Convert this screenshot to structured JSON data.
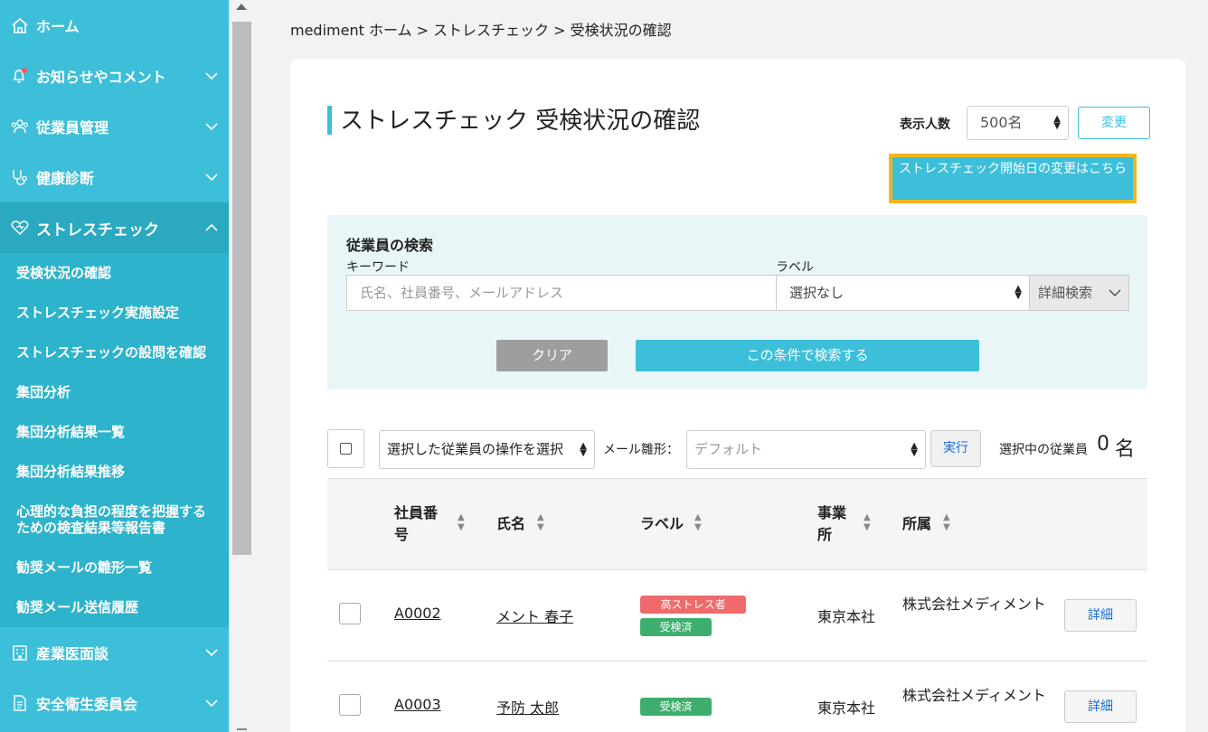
{
  "sidebar": {
    "home_label": "ホーム",
    "sections": [
      {
        "label": "お知らせやコメント",
        "icon": "bell-icon"
      },
      {
        "label": "従業員管理",
        "icon": "people-icon"
      },
      {
        "label": "健康診断",
        "icon": "stethoscope-icon"
      },
      {
        "label": "ストレスチェック",
        "icon": "heart-icon"
      },
      {
        "label": "産業医面談",
        "icon": "building-icon"
      },
      {
        "label": "安全衛生委員会",
        "icon": "document-icon"
      }
    ],
    "stress_items": [
      "受検状況の確認",
      "ストレスチェック実施設定",
      "ストレスチェックの設問を確認",
      "集団分析",
      "集団分析結果一覧",
      "集団分析結果推移",
      "心理的な負担の程度を把握するための検査結果等報告書",
      "勧奨メールの雛形一覧",
      "勧奨メール送信履歴"
    ]
  },
  "breadcrumb": "mediment ホーム > ストレスチェック > 受検状況の確認",
  "page_title": "ストレスチェック 受検状況の確認",
  "display": {
    "label": "表示人数",
    "value": "500名",
    "change_button": "変更"
  },
  "start_date_button": "ストレスチェック開始日の変更はこちら",
  "search": {
    "title": "従業員の検索",
    "keyword_label": "キーワード",
    "keyword_placeholder": "氏名、社員番号、メールアドレス",
    "label_label": "ラベル",
    "label_value": "選択なし",
    "advanced": "詳細検索",
    "clear_button": "クリア",
    "search_button": "この条件で検索する"
  },
  "bulk": {
    "operation_placeholder": "選択した従業員の操作を選択",
    "mail_label": "メール雛形：",
    "mail_value": "デフォルト",
    "exec_button": "実行",
    "selected_label": "選択中の従業員",
    "selected_count": "0",
    "selected_unit": "名"
  },
  "table": {
    "headers": {
      "employee_id": "社員番号",
      "name": "氏名",
      "label": "ラベル",
      "office": "事業所",
      "affiliation": "所属"
    },
    "detail_label": "詳細",
    "rows": [
      {
        "id": "A0002",
        "name": "メント 春子",
        "tags": [
          "高ストレス者",
          "受検済"
        ],
        "office": "東京本社",
        "affiliation": "株式会社メディメント"
      },
      {
        "id": "A0003",
        "name": "予防 太郎",
        "tags": [
          "受検済"
        ],
        "office": "東京本社",
        "affiliation": "株式会社メディメント"
      }
    ]
  },
  "colors": {
    "primary": "#3dbfd9",
    "highlight_border": "#f2b51b",
    "high_stress_tag": "#ef6b6b",
    "done_tag": "#3dae6d"
  }
}
